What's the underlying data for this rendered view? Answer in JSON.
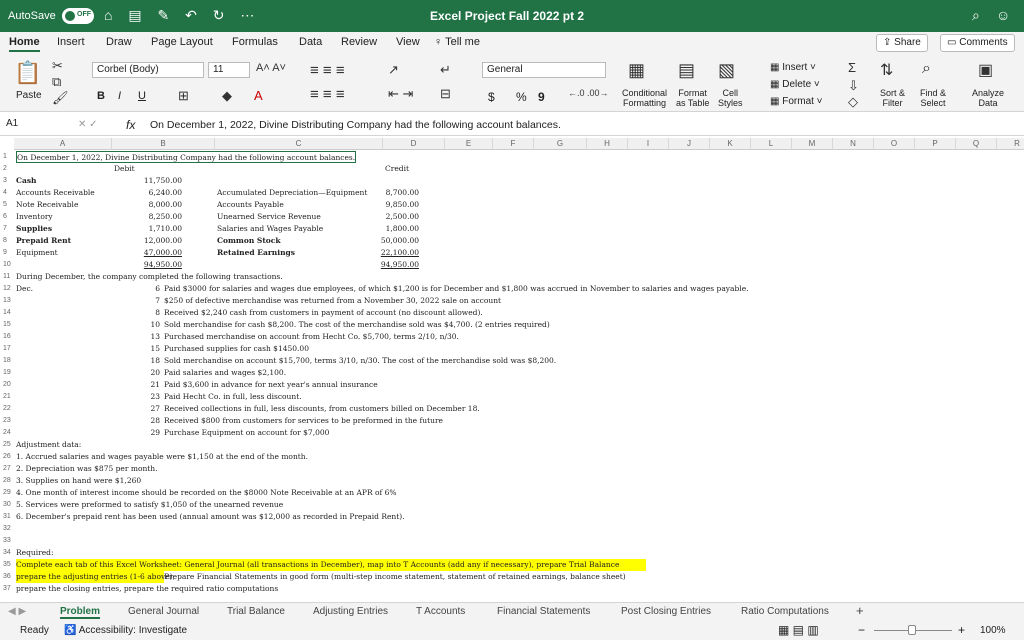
{
  "title": {
    "autosave": "AutoSave",
    "toggle": "OFF",
    "doc": "Excel Project Fall 2022 pt 2"
  },
  "menu": {
    "items": [
      "Home",
      "Insert",
      "Draw",
      "Page Layout",
      "Formulas",
      "Data",
      "Review",
      "View"
    ],
    "tellme": "Tell me",
    "share": "Share",
    "comments": "Comments"
  },
  "ribbon": {
    "paste": "Paste",
    "font": "Corbel (Body)",
    "size": "11",
    "bold": "B",
    "italic": "I",
    "underline": "U",
    "number_format": "General",
    "dollar": "$",
    "percent": "%",
    "comma": "9",
    "conditional": "Conditional\nFormatting",
    "format_table": "Format\nas Table",
    "cell_styles": "Cell\nStyles",
    "insert": "Insert",
    "delete": "Delete",
    "format": "Format",
    "sort": "Sort &\nFilter",
    "find": "Find &\nSelect",
    "analyze": "Analyze\nData"
  },
  "formula_bar": {
    "cell_ref": "A1",
    "fx": "fx",
    "content": "On December 1, 2022, Divine Distributing Company had the following account balances."
  },
  "columns": [
    "A",
    "B",
    "C",
    "D",
    "E",
    "F",
    "G",
    "H",
    "I",
    "J",
    "K",
    "L",
    "M",
    "N",
    "O",
    "P",
    "Q",
    "R",
    "S"
  ],
  "rows": [
    "1",
    "2",
    "3",
    "4",
    "5",
    "6",
    "7",
    "8",
    "9",
    "10",
    "11",
    "12",
    "13",
    "14",
    "15",
    "16",
    "17",
    "18",
    "19",
    "20",
    "21",
    "22",
    "23",
    "24",
    "25",
    "26",
    "27",
    "28",
    "29",
    "30",
    "31",
    "32",
    "33",
    "34",
    "35",
    "36",
    "37"
  ],
  "sheet": {
    "r1": "On December 1, 2022, Divine Distributing Company had the following account balances.",
    "debit": "Debit",
    "credit": "Credit",
    "accounts": [
      {
        "a": "Cash",
        "b": "11,750.00",
        "c": "",
        "d": ""
      },
      {
        "a": "Accounts Receivable",
        "b": "6,240.00",
        "c": "Accumulated Depreciation—Equipment",
        "d": "8,700.00"
      },
      {
        "a": "Note Receivable",
        "b": "8,000.00",
        "c": "Accounts Payable",
        "d": "9,850.00"
      },
      {
        "a": "Inventory",
        "b": "8,250.00",
        "c": "Unearned Service Revenue",
        "d": "2,500.00"
      },
      {
        "a": "Supplies",
        "b": "1,710.00",
        "c": "Salaries and Wages Payable",
        "d": "1,800.00"
      },
      {
        "a": "Prepaid Rent",
        "b": "12,000.00",
        "c": "Common Stock",
        "d": "50,000.00"
      },
      {
        "a": "Equipment",
        "b": "47,000.00",
        "c": "Retained Earnings",
        "d": "22,100.00"
      }
    ],
    "total_b": "94,950.00",
    "total_d": "94,950.00",
    "r11": "During December, the company completed the following transactions.",
    "dec": "Dec.",
    "transactions": [
      {
        "n": "6",
        "t": "Paid $3000 for salaries and wages due employees, of which $1,200 is for December and $1,800 was accrued in November to salaries and wages payable."
      },
      {
        "n": "7",
        "t": "$250 of defective merchandise was returned from a November 30, 2022 sale on account"
      },
      {
        "n": "8",
        "t": "Received $2,240 cash from customers in payment of account (no discount allowed)."
      },
      {
        "n": "10",
        "t": "Sold merchandise for cash $8,200. The cost of the merchandise sold was $4,700. (2 entries required)"
      },
      {
        "n": "13",
        "t": "Purchased merchandise on account from Hecht Co. $5,700, terms 2/10, n/30."
      },
      {
        "n": "15",
        "t": "Purchased supplies for cash $1450.00"
      },
      {
        "n": "18",
        "t": "Sold merchandise on account $15,700, terms 3/10, n/30. The cost of the merchandise sold was $8,200."
      },
      {
        "n": "20",
        "t": "Paid salaries and wages $2,100."
      },
      {
        "n": "21",
        "t": "Paid $3,600 in advance for next year's annual insurance"
      },
      {
        "n": "23",
        "t": "Paid Hecht Co. in full, less discount."
      },
      {
        "n": "27",
        "t": "Received collections in full, less discounts, from customers billed on December 18."
      },
      {
        "n": "28",
        "t": "Received $800 from customers for services to be preformed in the future"
      },
      {
        "n": "29",
        "t": "Purchase Equipment on account for $7,000"
      }
    ],
    "adj_title": "Adjustment data:",
    "adjustments": [
      "1. Accrued salaries and wages payable were $1,150 at the end of the month.",
      "2. Depreciation was $875 per month.",
      "3. Supplies on hand were $1,260",
      "4.  One month of interest income should be recorded on the $8000 Note Receivable at an APR of 6%",
      "5. Services were preformed to satisfy $1,050 of the unearned revenue",
      "6. December's prepaid rent has been used (annual amount was $12,000 as recorded in Prepaid Rent)."
    ],
    "required": "Required:",
    "r35": "Complete each tab of this Excel Worksheet: General Journal (all transactions in December), map into T Accounts (add any if necessary), prepare Trial Balance",
    "r36a": "prepare the adjusting entries (1-6 above),",
    "r36b": " Prepare Financial Statements in good form (multi-step income statement, statement of retained earnings, balance sheet)",
    "r37": "prepare the closing entries, prepare the required ratio computations"
  },
  "sheet_tabs": [
    "Problem",
    "General Journal",
    "Trial Balance",
    "Adjusting Entries",
    "T Accounts",
    "Financial Statements",
    "Post Closing Entries",
    "Ratio Computations"
  ],
  "status": {
    "ready": "Ready",
    "accessibility": "Accessibility: Investigate",
    "zoom": "100%"
  }
}
